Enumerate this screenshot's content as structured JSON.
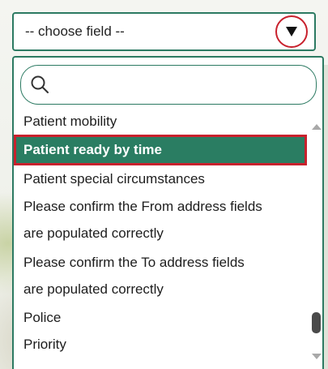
{
  "select": {
    "value": "-- choose field --",
    "arrow_icon": "triangle-down-icon",
    "highlight_color": "#c8212d"
  },
  "search": {
    "icon": "search-icon",
    "placeholder": "",
    "value": ""
  },
  "options": [
    {
      "label": "Patient mobility",
      "selected": false
    },
    {
      "label": "Patient ready by time",
      "selected": true
    },
    {
      "label": "Patient special circumstances",
      "selected": false
    },
    {
      "label": "Please confirm the From address fields are populated correctly",
      "line1": "Please confirm the From address fields",
      "line2": "are populated correctly",
      "selected": false
    },
    {
      "label": "Please confirm the To address fields are populated correctly",
      "line1": "Please confirm the To address fields",
      "line2": "are populated correctly",
      "selected": false
    },
    {
      "label": "Police",
      "selected": false
    },
    {
      "label": "Priority",
      "selected": false
    }
  ],
  "colors": {
    "accent": "#2a7d62",
    "selected_text": "#ffffff",
    "focus_outline": "#c8212d"
  }
}
